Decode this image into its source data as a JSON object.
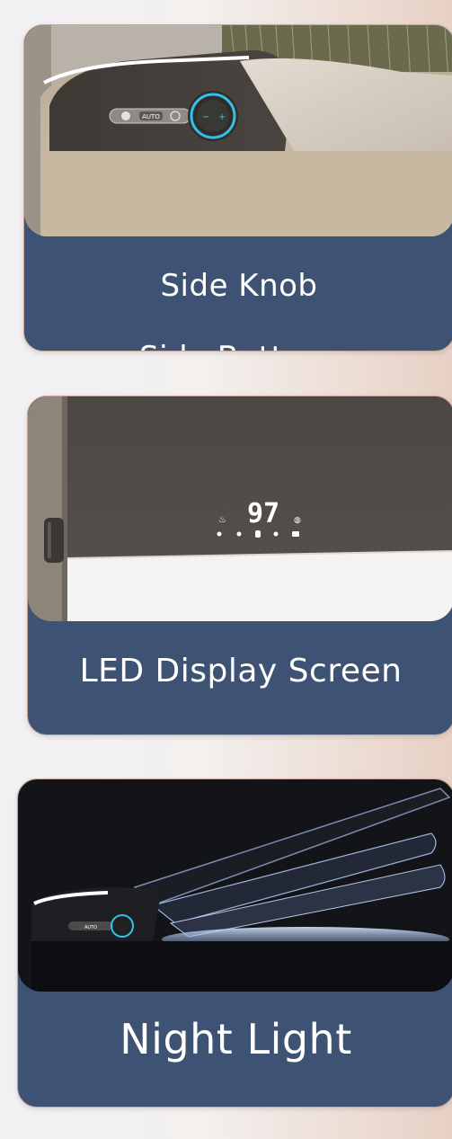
{
  "cards": [
    {
      "captions": [
        "Side Knob",
        "Side Buttons"
      ],
      "photo": {
        "buttons": [
          "AUTO"
        ],
        "icons": [
          "fan-icon",
          "power-icon",
          "minus-icon",
          "plus-icon"
        ]
      }
    },
    {
      "captions": [
        "LED Display Screen"
      ],
      "photo": {
        "display_value": "97",
        "icons": [
          "temperature-icon",
          "seat-icon",
          "shield-icon",
          "dryer-icon",
          "flush-icon",
          "signal-icon"
        ]
      }
    },
    {
      "captions": [
        "Night Light"
      ],
      "photo": {
        "buttons": [
          "AUTO"
        ]
      }
    }
  ],
  "colors": {
    "panel_blue": "#3e5274",
    "knob_ring": "#33c2e6",
    "led_white": "#ffffff"
  }
}
